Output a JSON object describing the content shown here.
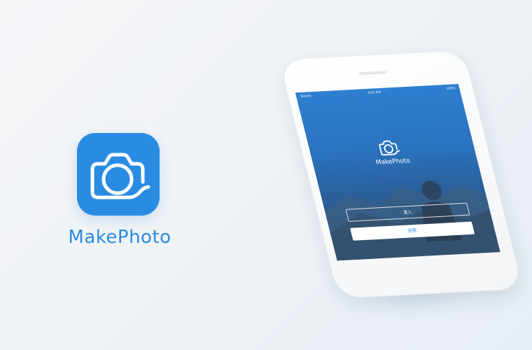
{
  "brand": {
    "name": "MakePhoto",
    "color": "#2a8be3"
  },
  "phone_screen": {
    "status": {
      "carrier": "Sketch",
      "time": "9:41 AM",
      "battery": "100%"
    },
    "title": "MakePhoto",
    "login_label": "登入",
    "register_label": "註冊"
  },
  "icons": {
    "app_icon": "camera-icon",
    "screen_logo": "camera-icon"
  }
}
